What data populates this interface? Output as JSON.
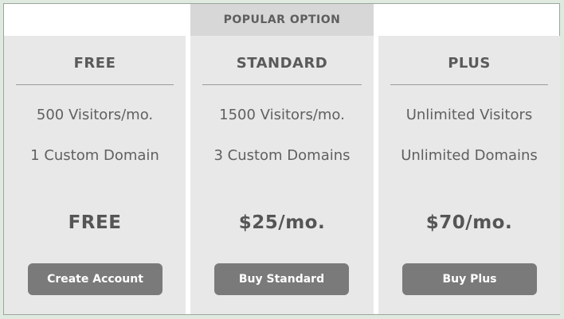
{
  "banner": "POPULAR OPTION",
  "plans": {
    "free": {
      "title": "FREE",
      "features": [
        "500 Visitors/mo.",
        "1 Custom Domain"
      ],
      "price": "FREE",
      "button": "Create Account"
    },
    "standard": {
      "title": "STANDARD",
      "features": [
        "1500 Visitors/mo.",
        "3 Custom Domains"
      ],
      "price": "$25/mo.",
      "button": "Buy Standard"
    },
    "plus": {
      "title": "PLUS",
      "features": [
        "Unlimited Visitors",
        "Unlimited Domains"
      ],
      "price": "$70/mo.",
      "button": "Buy Plus"
    }
  },
  "colors": {
    "card_bg": "#e8e8e8",
    "banner_bg": "#d7d7d7",
    "button_bg": "#7a7a7a",
    "text": "#555555"
  }
}
